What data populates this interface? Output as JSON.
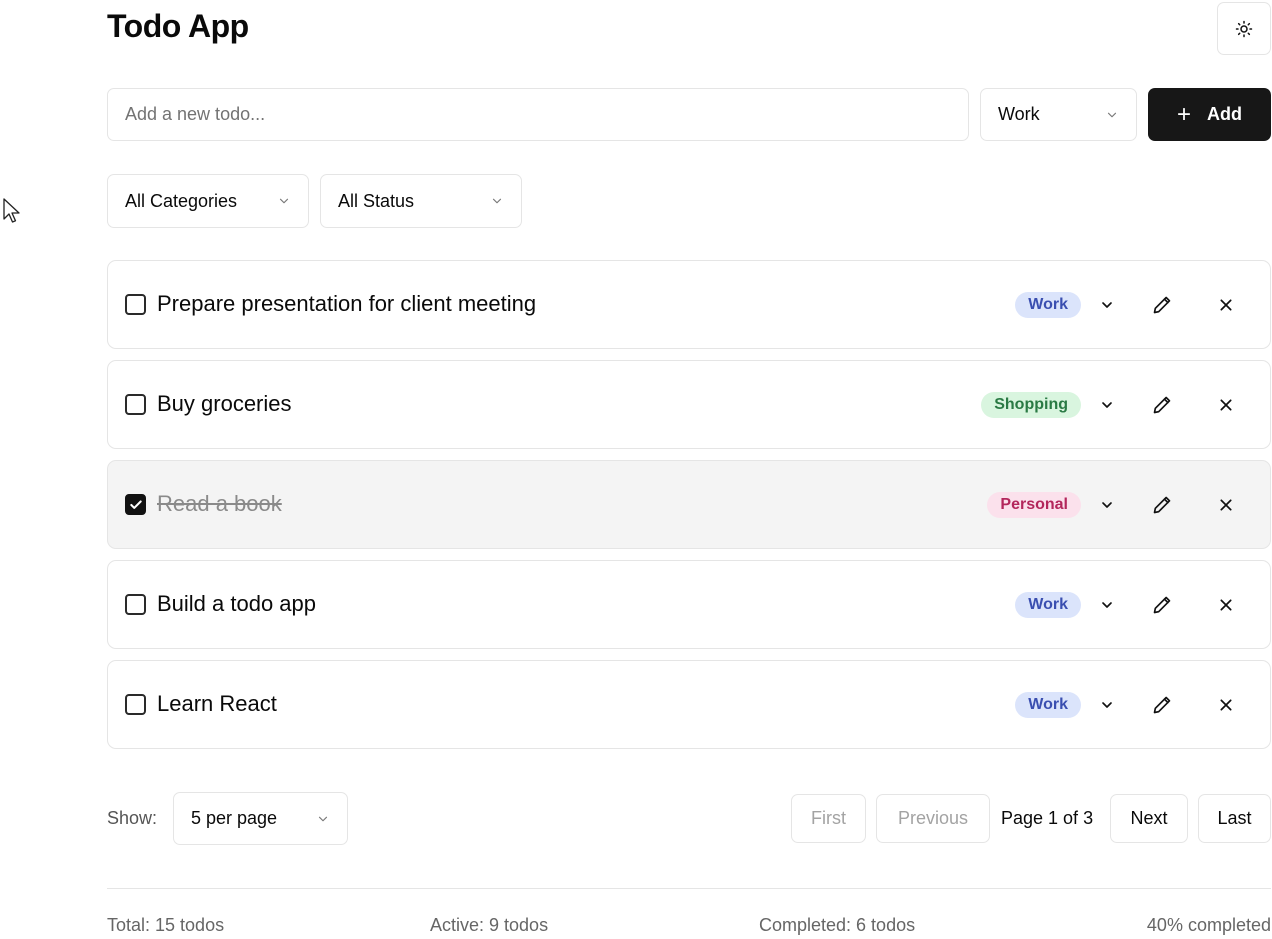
{
  "header": {
    "title": "Todo App",
    "theme_icon": "sun-icon"
  },
  "new_todo": {
    "placeholder": "Add a new todo...",
    "category": "Work",
    "add_label": "Add"
  },
  "filters": {
    "category": "All Categories",
    "status": "All Status"
  },
  "todos": [
    {
      "text": "Prepare presentation for client meeting",
      "category": "Work",
      "completed": false
    },
    {
      "text": "Buy groceries",
      "category": "Shopping",
      "completed": false
    },
    {
      "text": "Read a book",
      "category": "Personal",
      "completed": true
    },
    {
      "text": "Build a todo app",
      "category": "Work",
      "completed": false
    },
    {
      "text": "Learn React",
      "category": "Work",
      "completed": false
    }
  ],
  "badge_colors": {
    "Work": {
      "bg": "#dbe4fb",
      "fg": "#3b4fb0"
    },
    "Shopping": {
      "bg": "#d9f5df",
      "fg": "#2a7a44"
    },
    "Personal": {
      "bg": "#fbe1ec",
      "fg": "#b3275c"
    }
  },
  "pagination": {
    "show_label": "Show:",
    "per_page": "5 per page",
    "first": "First",
    "previous": "Previous",
    "page_info": "Page 1 of 3",
    "next": "Next",
    "last": "Last"
  },
  "stats": {
    "total": "Total: 15 todos",
    "active": "Active: 9 todos",
    "completed": "Completed: 6 todos",
    "percent": "40% completed"
  }
}
